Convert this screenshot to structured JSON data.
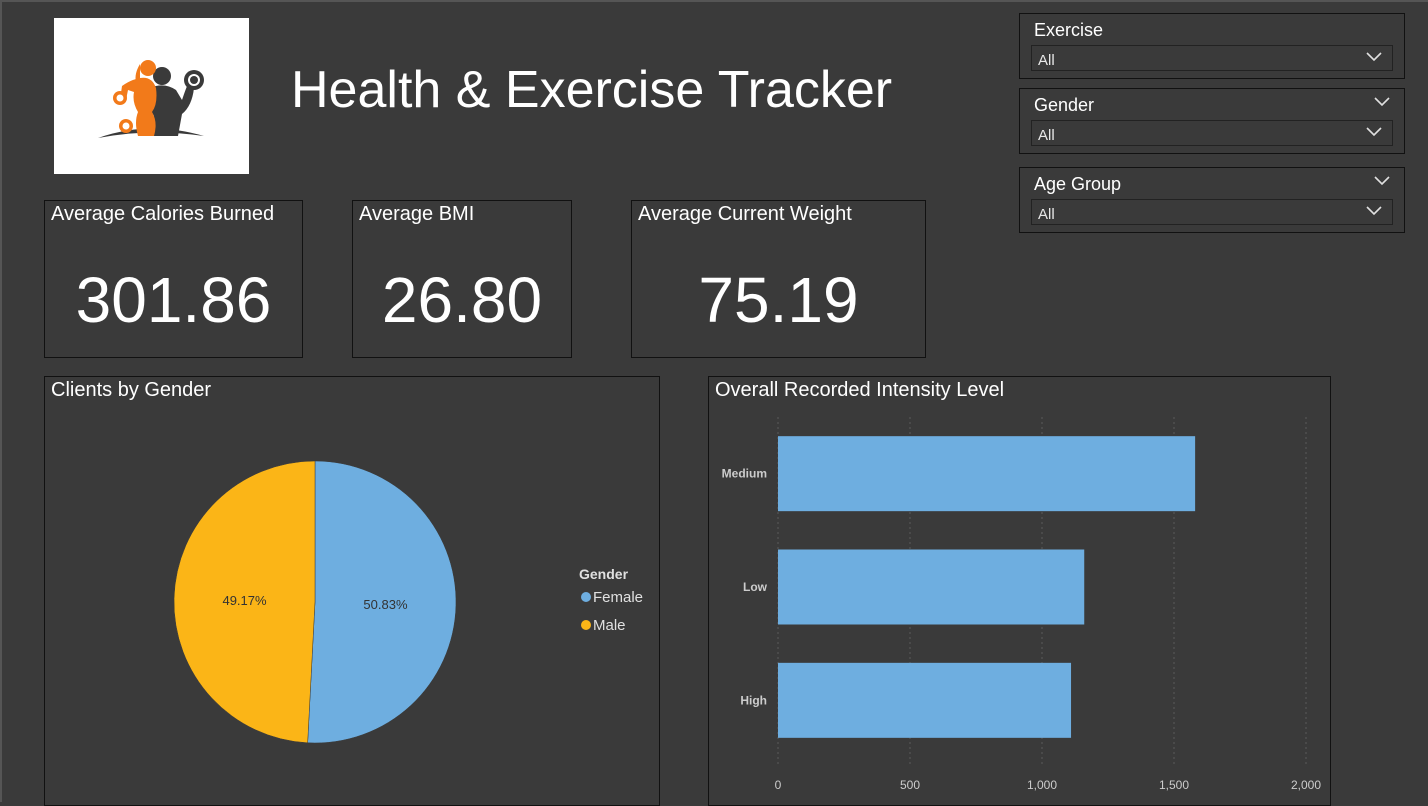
{
  "header": {
    "title": "Health & Exercise Tracker"
  },
  "kpis": [
    {
      "label": "Average Calories Burned",
      "value": "301.86"
    },
    {
      "label": "Average BMI",
      "value": "26.80"
    },
    {
      "label": "Average Current Weight",
      "value": "75.19"
    }
  ],
  "slicers": [
    {
      "label": "Exercise",
      "value": "All",
      "icon": "chevron-down-icon"
    },
    {
      "label": "Gender",
      "value": "All",
      "icon": "chevron-down-icon"
    },
    {
      "label": "Age Group",
      "value": "All",
      "icon": "chevron-down-icon"
    }
  ],
  "colors": {
    "female": "#6eaee0",
    "male": "#fbb517",
    "background": "#3a3a3a",
    "logo_accent": "#f27a1a"
  },
  "chart_data": [
    {
      "type": "pie",
      "title": "Clients by Gender",
      "legend_title": "Gender",
      "legend_position": "right",
      "slices": [
        {
          "label": "Female",
          "value": 50.83,
          "display": "50.83%"
        },
        {
          "label": "Male",
          "value": 49.17,
          "display": "49.17%"
        }
      ]
    },
    {
      "type": "bar",
      "orientation": "horizontal",
      "title": "Overall Recorded Intensity Level",
      "categories": [
        "Medium",
        "Low",
        "High"
      ],
      "values": [
        1580,
        1160,
        1110
      ],
      "xlim": [
        0,
        2000
      ],
      "xticks": [
        0,
        500,
        1000,
        1500,
        2000
      ],
      "xtick_labels": [
        "0",
        "500",
        "1,000",
        "1,500",
        "2,000"
      ],
      "grid": true
    }
  ]
}
